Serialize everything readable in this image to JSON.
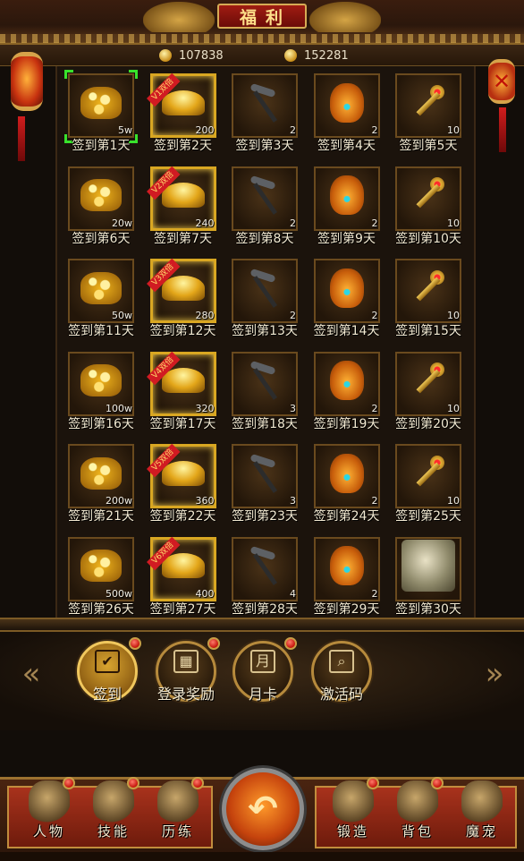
{
  "header": {
    "title": "福利"
  },
  "currency": {
    "gold": "107838",
    "coins": "152281"
  },
  "rewards": [
    {
      "label": "签到第1天",
      "qty": "5w",
      "icon": "gold-coins",
      "vip": "",
      "selected": true
    },
    {
      "label": "签到第2天",
      "qty": "200",
      "icon": "gold-ingot",
      "vip": "V1双倍",
      "selected": false
    },
    {
      "label": "签到第3天",
      "qty": "2",
      "icon": "pickaxe",
      "vip": "",
      "selected": false
    },
    {
      "label": "签到第4天",
      "qty": "2",
      "icon": "treasure-bag",
      "vip": "",
      "selected": false
    },
    {
      "label": "签到第5天",
      "qty": "10",
      "icon": "golden-key",
      "vip": "",
      "selected": false
    },
    {
      "label": "签到第6天",
      "qty": "20w",
      "icon": "gold-coins",
      "vip": "",
      "selected": false
    },
    {
      "label": "签到第7天",
      "qty": "240",
      "icon": "gold-ingot",
      "vip": "V2双倍",
      "selected": false
    },
    {
      "label": "签到第8天",
      "qty": "2",
      "icon": "pickaxe",
      "vip": "",
      "selected": false
    },
    {
      "label": "签到第9天",
      "qty": "2",
      "icon": "treasure-bag",
      "vip": "",
      "selected": false
    },
    {
      "label": "签到第10天",
      "qty": "10",
      "icon": "golden-key",
      "vip": "",
      "selected": false
    },
    {
      "label": "签到第11天",
      "qty": "50w",
      "icon": "gold-coins",
      "vip": "",
      "selected": false
    },
    {
      "label": "签到第12天",
      "qty": "280",
      "icon": "gold-ingot",
      "vip": "V3双倍",
      "selected": false
    },
    {
      "label": "签到第13天",
      "qty": "2",
      "icon": "pickaxe",
      "vip": "",
      "selected": false
    },
    {
      "label": "签到第14天",
      "qty": "2",
      "icon": "treasure-bag",
      "vip": "",
      "selected": false
    },
    {
      "label": "签到第15天",
      "qty": "10",
      "icon": "golden-key",
      "vip": "",
      "selected": false
    },
    {
      "label": "签到第16天",
      "qty": "100w",
      "icon": "gold-coins",
      "vip": "",
      "selected": false
    },
    {
      "label": "签到第17天",
      "qty": "320",
      "icon": "gold-ingot",
      "vip": "V4双倍",
      "selected": false
    },
    {
      "label": "签到第18天",
      "qty": "3",
      "icon": "pickaxe",
      "vip": "",
      "selected": false
    },
    {
      "label": "签到第19天",
      "qty": "2",
      "icon": "treasure-bag",
      "vip": "",
      "selected": false
    },
    {
      "label": "签到第20天",
      "qty": "10",
      "icon": "golden-key",
      "vip": "",
      "selected": false
    },
    {
      "label": "签到第21天",
      "qty": "200w",
      "icon": "gold-coins",
      "vip": "",
      "selected": false
    },
    {
      "label": "签到第22天",
      "qty": "360",
      "icon": "gold-ingot",
      "vip": "V5双倍",
      "selected": false
    },
    {
      "label": "签到第23天",
      "qty": "3",
      "icon": "pickaxe",
      "vip": "",
      "selected": false
    },
    {
      "label": "签到第24天",
      "qty": "2",
      "icon": "treasure-bag",
      "vip": "",
      "selected": false
    },
    {
      "label": "签到第25天",
      "qty": "10",
      "icon": "golden-key",
      "vip": "",
      "selected": false
    },
    {
      "label": "签到第26天",
      "qty": "500w",
      "icon": "gold-coins",
      "vip": "",
      "selected": false
    },
    {
      "label": "签到第27天",
      "qty": "400",
      "icon": "gold-ingot",
      "vip": "V6双倍",
      "selected": false
    },
    {
      "label": "签到第28天",
      "qty": "4",
      "icon": "pickaxe",
      "vip": "",
      "selected": false
    },
    {
      "label": "签到第29天",
      "qty": "2",
      "icon": "treasure-bag",
      "vip": "",
      "selected": false
    },
    {
      "label": "签到第30天",
      "qty": "",
      "icon": "monster-pet",
      "vip": "",
      "selected": false
    }
  ],
  "tabs": [
    {
      "label": "签到",
      "icon": "calendar-check-icon",
      "glyph": "✔",
      "active": true,
      "badge": true
    },
    {
      "label": "登录奖励",
      "icon": "gift-icon",
      "glyph": "▦",
      "active": false,
      "badge": true
    },
    {
      "label": "月卡",
      "icon": "month-card-icon",
      "glyph": "月",
      "active": false,
      "badge": true
    },
    {
      "label": "激活码",
      "icon": "activation-code-icon",
      "glyph": "⌕",
      "active": false,
      "badge": false
    }
  ],
  "nav": [
    {
      "label": "人物",
      "icon": "character-icon",
      "badge": true
    },
    {
      "label": "技能",
      "icon": "skill-icon",
      "badge": true
    },
    {
      "label": "历练",
      "icon": "training-icon",
      "badge": true
    },
    {
      "label": "锻造",
      "icon": "forge-icon",
      "badge": true
    },
    {
      "label": "背包",
      "icon": "backpack-icon",
      "badge": true
    },
    {
      "label": "魔宠",
      "icon": "magic-pet-icon",
      "badge": false
    }
  ],
  "center_button": {
    "glyph": "↶"
  }
}
